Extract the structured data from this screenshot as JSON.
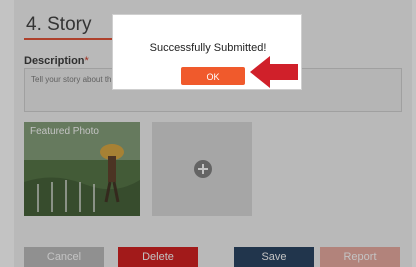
{
  "section": {
    "title": "4. Story"
  },
  "description": {
    "label": "Description",
    "required_mark": "*",
    "placeholder": "Tell your story about th"
  },
  "photos": {
    "featured_caption": "Featured Photo",
    "add_icon": "plus-circle-icon"
  },
  "actions": {
    "cancel": "Cancel",
    "delete": "Delete",
    "save": "Save",
    "report": "Report"
  },
  "dialog": {
    "message": "Successfully  Submitted!",
    "ok": "OK"
  },
  "colors": {
    "accent": "#f05a2c",
    "delete": "#d11515",
    "save": "#1f3b5a",
    "arrow": "#d0202a"
  }
}
